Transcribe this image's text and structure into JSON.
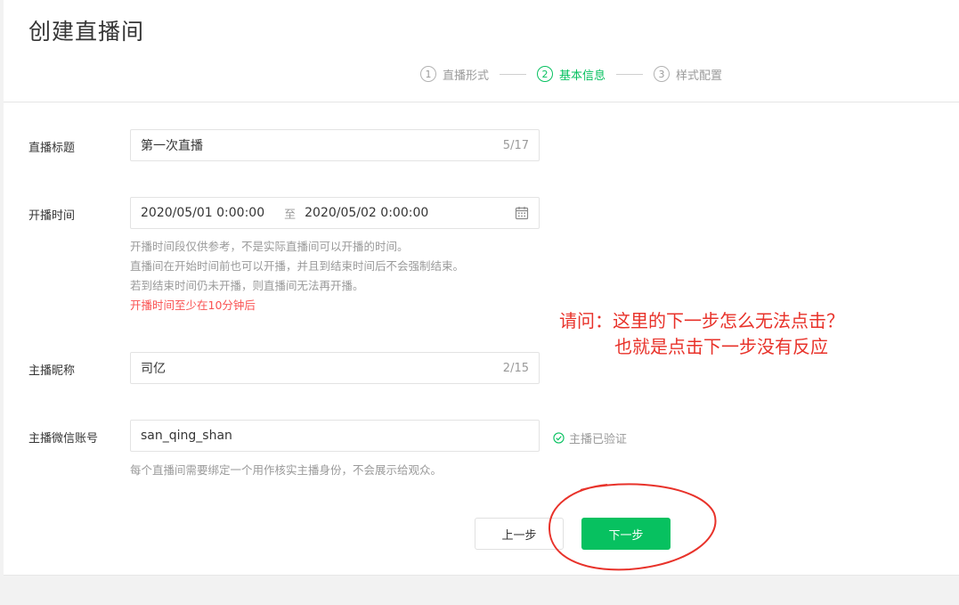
{
  "page": {
    "title": "创建直播间"
  },
  "steps": [
    {
      "num": "1",
      "label": "直播形式",
      "active": false
    },
    {
      "num": "2",
      "label": "基本信息",
      "active": true
    },
    {
      "num": "3",
      "label": "样式配置",
      "active": false
    }
  ],
  "form": {
    "title": {
      "label": "直播标题",
      "value": "第一次直播",
      "counter": "5/17"
    },
    "time": {
      "label": "开播时间",
      "start": "2020/05/01 0:00:00",
      "separator": "至",
      "end": "2020/05/02 0:00:00",
      "help": [
        "开播时间段仅供参考，不是实际直播间可以开播的时间。",
        "直播间在开始时间前也可以开播，并且到结束时间后不会强制结束。",
        "若到结束时间仍未开播，则直播间无法再开播。"
      ],
      "warning": "开播时间至少在10分钟后"
    },
    "nickname": {
      "label": "主播昵称",
      "value": "司亿",
      "counter": "2/15"
    },
    "wechat": {
      "label": "主播微信账号",
      "value": "san_qing_shan",
      "verified": "主播已验证",
      "help": "每个直播间需要绑定一个用作核实主播身份，不会展示给观众。"
    }
  },
  "buttons": {
    "prev": "上一步",
    "next": "下一步"
  },
  "annotation": {
    "line1": "请问：这里的下一步怎么无法点击？",
    "line2": "也就是点击下一步没有反应",
    "color": "#e8322a"
  },
  "colors": {
    "accent": "#07c160",
    "warning": "#fa5151"
  },
  "icons": {
    "date": "calendar-icon",
    "verified": "check-circle-icon"
  }
}
